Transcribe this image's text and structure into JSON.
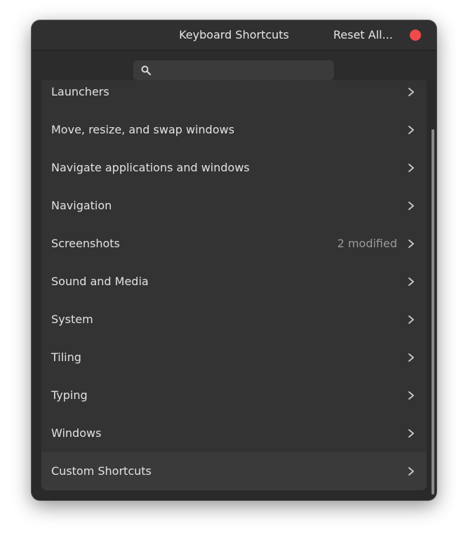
{
  "window": {
    "title": "Keyboard Shortcuts",
    "reset_label": "Reset All...",
    "close_color": "#f04a4a"
  },
  "search": {
    "placeholder": "",
    "value": ""
  },
  "categories": [
    {
      "label": "Launchers",
      "status": ""
    },
    {
      "label": "Move, resize, and swap windows",
      "status": ""
    },
    {
      "label": "Navigate applications and windows",
      "status": ""
    },
    {
      "label": "Navigation",
      "status": ""
    },
    {
      "label": "Screenshots",
      "status": "2 modified"
    },
    {
      "label": "Sound and Media",
      "status": ""
    },
    {
      "label": "System",
      "status": ""
    },
    {
      "label": "Tiling",
      "status": ""
    },
    {
      "label": "Typing",
      "status": ""
    },
    {
      "label": "Windows",
      "status": ""
    },
    {
      "label": "Custom Shortcuts",
      "status": ""
    }
  ],
  "icons": {
    "search": "search-icon",
    "row_arrow": "chevron-right-icon",
    "close": "close-icon"
  }
}
